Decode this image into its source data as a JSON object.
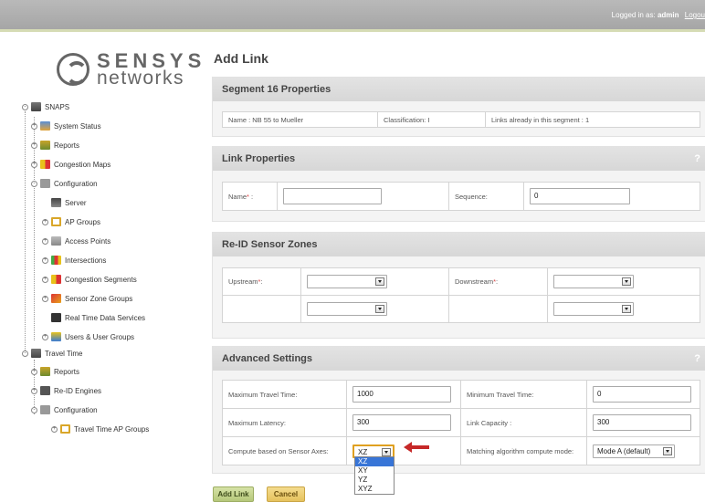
{
  "topbar": {
    "login_prefix": "Logged in as:",
    "username": "admin",
    "logout": "Logou"
  },
  "logo": {
    "line1": "SENSYS",
    "line2": "networks"
  },
  "tree": {
    "snaps": "SNAPS",
    "system_status": "System Status",
    "reports": "Reports",
    "congestion_maps": "Congestion Maps",
    "configuration": "Configuration",
    "server": "Server",
    "ap_groups": "AP Groups",
    "access_points": "Access Points",
    "intersections": "Intersections",
    "congestion_segments": "Congestion Segments",
    "sensor_zone_groups": "Sensor Zone Groups",
    "real_time_data_services": "Real Time Data Services",
    "users_user_groups": "Users & User Groups",
    "travel_time": "Travel Time",
    "tt_reports": "Reports",
    "reid_engines": "Re-ID Engines",
    "tt_configuration": "Configuration",
    "travel_time_ap_groups": "Travel Time AP Groups"
  },
  "page": {
    "title": "Add Link"
  },
  "segment": {
    "header": "Segment 16 Properties",
    "name": "Name : NB 55 to Mueller",
    "classification": "Classification: I",
    "links": "Links already in this segment : 1"
  },
  "link": {
    "header": "Link Properties",
    "help": "?",
    "name_label": "Name",
    "req": "*",
    "colon": " :",
    "name_value": "",
    "sequence_label": "Sequence:",
    "sequence_value": "0"
  },
  "reid": {
    "header": "Re-ID Sensor Zones",
    "upstream_label": "Upstream",
    "downstream_label": "Downstream",
    "colon": ":"
  },
  "advanced": {
    "header": "Advanced Settings",
    "help": "?",
    "max_travel_label": "Maximum Travel Time:",
    "max_travel_value": "1000",
    "min_travel_label": "Minimum Travel Time:",
    "min_travel_value": "0",
    "max_latency_label": "Maximum Latency:",
    "max_latency_value": "300",
    "link_capacity_label": "Link Capacity :",
    "link_capacity_value": "300",
    "compute_label": "Compute based on Sensor Axes:",
    "compute_value": "XZ",
    "match_label": "Matching algorithm compute mode:",
    "match_value": "Mode A (default)",
    "axes_options": [
      "XZ",
      "XY",
      "YZ",
      "XYZ"
    ]
  },
  "buttons": {
    "add_link": "Add Link",
    "cancel": "Cancel"
  },
  "colors": {
    "topbar": "#afafaf",
    "accent": "#d6dcb5",
    "highlight": "#3875d7",
    "arrow": "#c62828"
  }
}
